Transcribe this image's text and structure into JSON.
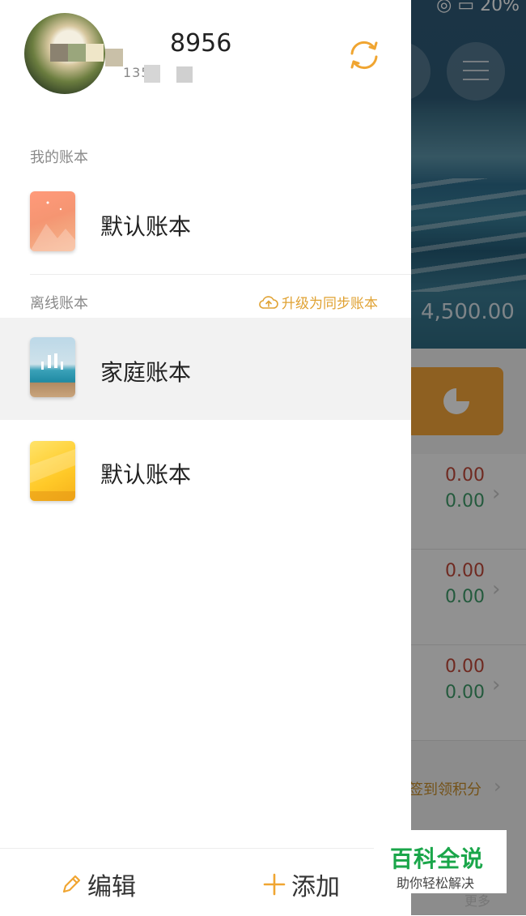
{
  "profile": {
    "username": "8956",
    "phone": "135",
    "sync_icon": "sync-icon"
  },
  "sections": {
    "my_books_label": "我的账本",
    "offline_books_label": "离线账本",
    "upgrade_label": "升级为同步账本"
  },
  "books": {
    "my": [
      {
        "name": "默认账本",
        "cover": "coral-mountain-cover"
      }
    ],
    "offline": [
      {
        "name": "家庭账本",
        "cover": "family-beach-cover",
        "selected": true
      },
      {
        "name": "默认账本",
        "cover": "yellow-cover"
      }
    ]
  },
  "bottom": {
    "edit_label": "编辑",
    "add_label": "添加"
  },
  "background": {
    "balance": "4,500.00",
    "rows": [
      {
        "income": "0.00",
        "expense": "0.00"
      },
      {
        "income": "0.00",
        "expense": "0.00"
      },
      {
        "income": "0.00",
        "expense": "0.00"
      }
    ],
    "checkin": "签到领积分",
    "more": "更多"
  },
  "watermark": {
    "title": "百科全说",
    "subtitle": "助你轻松解决"
  },
  "colors": {
    "accent": "#f4a63a",
    "upgrade": "#e0a233",
    "income": "#c0493a",
    "expense": "#3f9b6a",
    "watermark_green": "#1aa64a"
  }
}
